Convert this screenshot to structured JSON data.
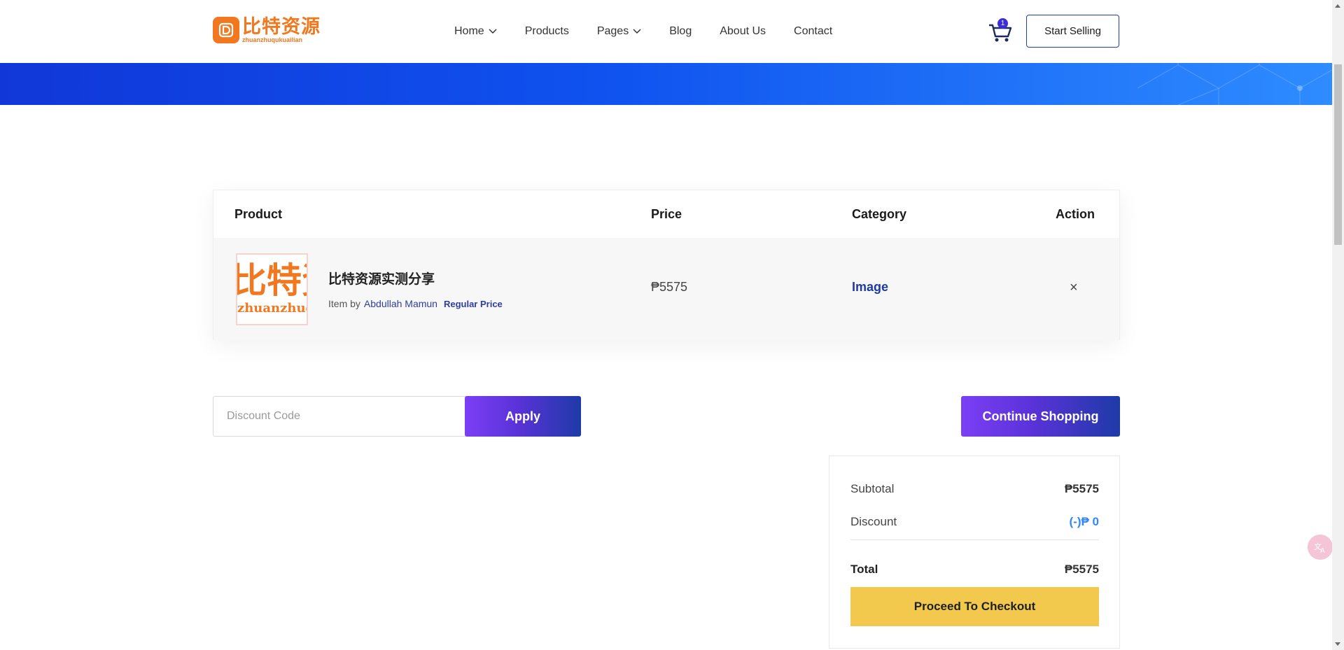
{
  "header": {
    "logo": {
      "cn": "比特资源",
      "en": "zhuanzhuqukuailian",
      "mark": "D"
    },
    "nav": [
      {
        "label": "Home",
        "has_dropdown": true
      },
      {
        "label": "Products",
        "has_dropdown": false
      },
      {
        "label": "Pages",
        "has_dropdown": true
      },
      {
        "label": "Blog",
        "has_dropdown": false
      },
      {
        "label": "About Us",
        "has_dropdown": false
      },
      {
        "label": "Contact",
        "has_dropdown": false
      }
    ],
    "cart_count": "1",
    "start_selling": "Start Selling"
  },
  "table": {
    "headers": {
      "product": "Product",
      "price": "Price",
      "category": "Category",
      "action": "Action"
    },
    "items": [
      {
        "thumb_cn": "比特资",
        "thumb_en": "zhuanzhuqu",
        "title": "比特资源实测分享",
        "item_by": "Item by",
        "author": "Abdullah Mamun",
        "license": "Regular Price",
        "price": "₱5575",
        "category": "Image",
        "remove": "×"
      }
    ]
  },
  "discount": {
    "placeholder": "Discount Code",
    "apply": "Apply"
  },
  "continue_shopping": "Continue Shopping",
  "summary": {
    "subtotal_label": "Subtotal",
    "subtotal_value": "₱5575",
    "discount_label": "Discount",
    "discount_value": "(-)₱ 0",
    "total_label": "Total",
    "total_value": "₱5575",
    "checkout": "Proceed To Checkout"
  },
  "colors": {
    "brand_orange": "#f2781f",
    "primary_blue": "#1e3aa3",
    "banner_blue": "#0f52ef",
    "gradient_purple": "#7b3ff5",
    "checkout_yellow": "#f2c94c",
    "discount_blue": "#2f86ff"
  },
  "icons": {
    "cart": "shopping-cart-icon",
    "chevron": "chevron-down-icon",
    "close": "close-icon",
    "translate": "translate-icon"
  }
}
